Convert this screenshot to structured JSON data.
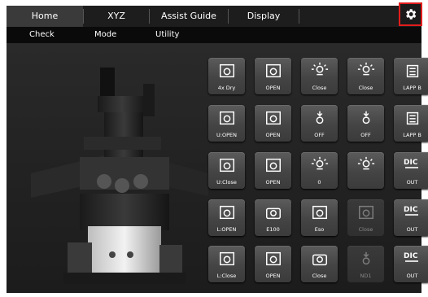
{
  "tabs": [
    "Home",
    "XYZ",
    "Assist Guide",
    "Display"
  ],
  "subtabs": [
    "Check",
    "Mode",
    "Utility"
  ],
  "settings_icon": "gear-icon",
  "colors": {
    "accent_border": "#e21c1c",
    "panel": "#262626",
    "button": "#4a4a4a"
  },
  "grid": [
    [
      {
        "label": "4x Dry",
        "icon": "objective-dry-icon",
        "enabled": true
      },
      {
        "label": "OPEN",
        "icon": "shutter-open-icon",
        "enabled": true
      },
      {
        "label": "Close",
        "icon": "lamp-close-icon",
        "enabled": true
      },
      {
        "label": "Close",
        "icon": "epi-lamp-close-icon",
        "enabled": true
      },
      {
        "label": "LAPP B",
        "icon": "lapp-1-icon",
        "enabled": true
      }
    ],
    [
      {
        "label": "U:OPEN",
        "icon": "upper-port-open-icon",
        "enabled": true
      },
      {
        "label": "OPEN",
        "icon": "port-1-open-icon",
        "enabled": true
      },
      {
        "label": "OFF",
        "icon": "filter-down-icon",
        "enabled": true
      },
      {
        "label": "OFF",
        "icon": "filter-up-icon",
        "enabled": true
      },
      {
        "label": "LAPP B",
        "icon": "lapp-2-icon",
        "enabled": true
      }
    ],
    [
      {
        "label": "U:Close",
        "icon": "upper-port-close-icon",
        "enabled": true
      },
      {
        "label": "OPEN",
        "icon": "port-2-open-icon",
        "enabled": true
      },
      {
        "label": "0",
        "icon": "intensity-icon",
        "enabled": true
      },
      {
        "label": "",
        "icon": "intensity-low-icon",
        "enabled": true
      },
      {
        "label": "OUT",
        "icon": "dic-icon",
        "enabled": true
      }
    ],
    [
      {
        "label": "L:OPEN",
        "icon": "lower-port-open-icon",
        "enabled": true
      },
      {
        "label": "E100",
        "icon": "camera-eyepiece-icon",
        "enabled": true
      },
      {
        "label": "Eso",
        "icon": "eso-icon",
        "enabled": true
      },
      {
        "label": "Close",
        "icon": "slider-close-icon",
        "enabled": false
      },
      {
        "label": "OUT",
        "icon": "dic-a-icon",
        "enabled": true
      }
    ],
    [
      {
        "label": "L:Close",
        "icon": "lower-port-close-icon",
        "enabled": true
      },
      {
        "label": "OPEN",
        "icon": "ex-shutter-open-icon",
        "enabled": true
      },
      {
        "label": "Close",
        "icon": "camera-close-icon",
        "enabled": true
      },
      {
        "label": "ND1",
        "icon": "nd-filter-icon",
        "enabled": false
      },
      {
        "label": "OUT",
        "icon": "dic-p-icon",
        "enabled": true
      }
    ]
  ]
}
